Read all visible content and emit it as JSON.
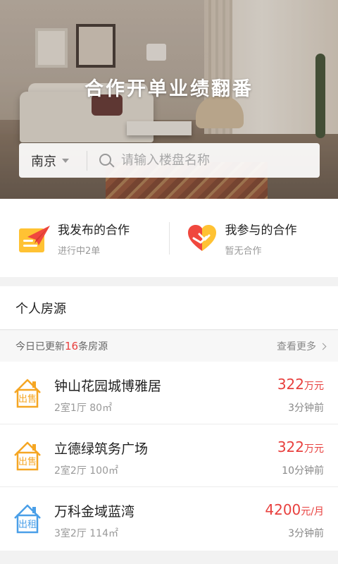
{
  "hero": {
    "title": "合作开单业绩翻番"
  },
  "search": {
    "city": "南京",
    "placeholder": "请输入楼盘名称"
  },
  "cooperation": [
    {
      "title": "我发布的合作",
      "subtitle": "进行中2单",
      "icon": "paper-plane-icon"
    },
    {
      "title": "我参与的合作",
      "subtitle": "暂无合作",
      "icon": "handshake-heart-icon"
    }
  ],
  "section": {
    "title": "个人房源"
  },
  "update_bar": {
    "prefix": "今日已更新",
    "count": "16",
    "suffix": "条房源",
    "more": "查看更多"
  },
  "listings": [
    {
      "tag": "出售",
      "name": "钟山花园城博雅居",
      "spec": "2室1厅  80㎡",
      "price": "322",
      "unit": "万元",
      "time": "3分钟前",
      "color": "#f5a623"
    },
    {
      "tag": "出售",
      "name": "立德绿筑务广场",
      "spec": "2室2厅  100㎡",
      "price": "322",
      "unit": "万元",
      "time": "10分钟前",
      "color": "#f5a623"
    },
    {
      "tag": "出租",
      "name": "万科金域蓝湾",
      "spec": "3室2厅  114㎡",
      "price": "4200",
      "unit": "元/月",
      "time": "3分钟前",
      "color": "#4a9fe8"
    }
  ],
  "colors": {
    "accent_red": "#e8403e",
    "sale_orange": "#f5a623",
    "rent_blue": "#4a9fe8"
  }
}
